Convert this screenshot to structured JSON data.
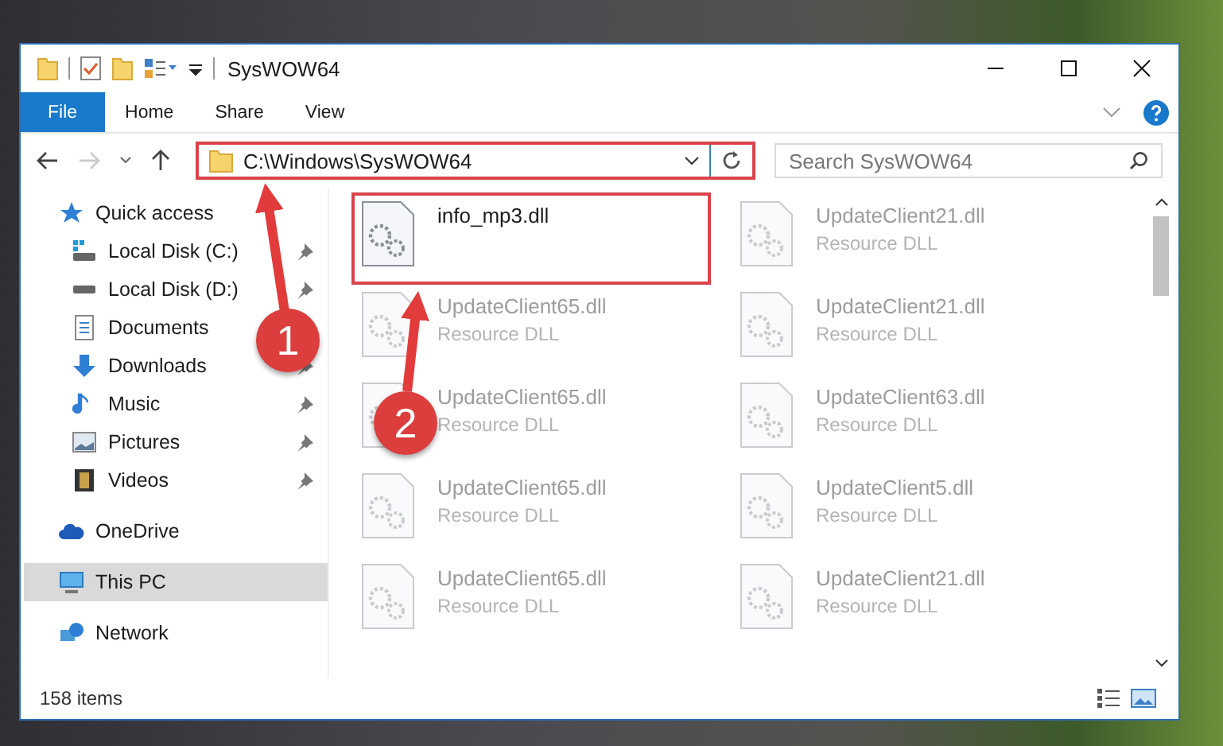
{
  "window": {
    "title": "SysWOW64"
  },
  "tabs": [
    {
      "label": "File",
      "kind": "file",
      "selected": false
    },
    {
      "label": "Home",
      "kind": "tab",
      "selected": false
    },
    {
      "label": "Share",
      "kind": "tab",
      "selected": false
    },
    {
      "label": "View",
      "kind": "tab",
      "selected": false
    }
  ],
  "address_bar": {
    "path": "C:\\Windows\\SysWOW64",
    "highlighted": true
  },
  "search": {
    "placeholder": "Search SysWOW64"
  },
  "sidebar": {
    "items": [
      {
        "label": "Quick access",
        "kind": "star",
        "selected": false,
        "children": [
          {
            "label": "Local Disk (C:)",
            "kind": "drive-c",
            "pinned": true,
            "selected": false
          },
          {
            "label": "Local Disk (D:)",
            "kind": "drive",
            "pinned": true,
            "selected": false
          },
          {
            "label": "Documents",
            "kind": "documents",
            "pinned": false,
            "selected": false
          },
          {
            "label": "Downloads",
            "kind": "downloads",
            "pinned": true,
            "selected": false
          },
          {
            "label": "Music",
            "kind": "music",
            "pinned": true,
            "selected": false
          },
          {
            "label": "Pictures",
            "kind": "pictures",
            "pinned": true,
            "selected": false
          },
          {
            "label": "Videos",
            "kind": "videos",
            "pinned": true,
            "selected": false
          }
        ]
      },
      {
        "label": "OneDrive",
        "kind": "cloud",
        "selected": false
      },
      {
        "label": "This PC",
        "kind": "pc",
        "selected": true
      },
      {
        "label": "Network",
        "kind": "network",
        "selected": false
      }
    ]
  },
  "files": [
    {
      "name": "info_mp3.dll",
      "highlighted": true,
      "blurred": false
    },
    {
      "name": "UpdateClient21.dll",
      "type": "Resource DLL",
      "highlighted": false,
      "blurred": true
    },
    {
      "name": "UpdateClient65.dll",
      "type": "Resource DLL",
      "highlighted": false,
      "blurred": true
    },
    {
      "name": "UpdateClient21.dll",
      "type": "Resource DLL",
      "highlighted": false,
      "blurred": true
    },
    {
      "name": "UpdateClient65.dll",
      "type": "Resource DLL",
      "highlighted": false,
      "blurred": true
    },
    {
      "name": "UpdateClient63.dll",
      "type": "Resource DLL",
      "highlighted": false,
      "blurred": true
    },
    {
      "name": "UpdateClient65.dll",
      "type": "Resource DLL",
      "highlighted": false,
      "blurred": true
    },
    {
      "name": "UpdateClient5.dll",
      "type": "Resource DLL",
      "highlighted": false,
      "blurred": true
    },
    {
      "name": "UpdateClient65.dll",
      "type": "Resource DLL",
      "highlighted": false,
      "blurred": true
    },
    {
      "name": "UpdateClient21.dll",
      "type": "Resource DLL",
      "highlighted": false,
      "blurred": true
    }
  ],
  "annotations": [
    {
      "label": "1"
    },
    {
      "label": "2"
    }
  ],
  "status_bar": {
    "item_count": "158 items"
  }
}
